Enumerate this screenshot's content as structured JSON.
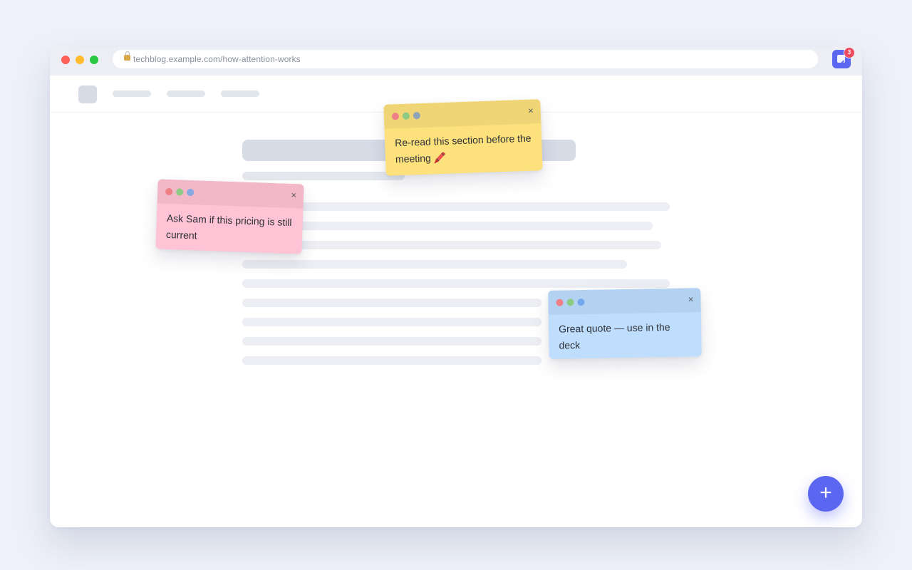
{
  "browser": {
    "url": "techblog.example.com/how-attention-works",
    "extension_badge_count": "3"
  },
  "notes": {
    "yellow": {
      "text": "Re-read this section before the meeting 🖍️",
      "close_label": "×"
    },
    "pink": {
      "text": "Ask Sam if this pricing is still current",
      "close_label": "×"
    },
    "blue": {
      "text": "Great quote — use in the deck",
      "close_label": "×"
    }
  },
  "fab": {
    "label": "+"
  },
  "icons": {
    "lock": "lock-icon",
    "extension": "sticky-note-icon",
    "close": "close-icon",
    "add": "plus-icon"
  },
  "colors": {
    "accent": "#5b67f1",
    "badge": "#ef4b5f",
    "note_yellow": "#fce17c",
    "note_pink": "#fec3d5",
    "note_blue": "#bfdefd"
  }
}
